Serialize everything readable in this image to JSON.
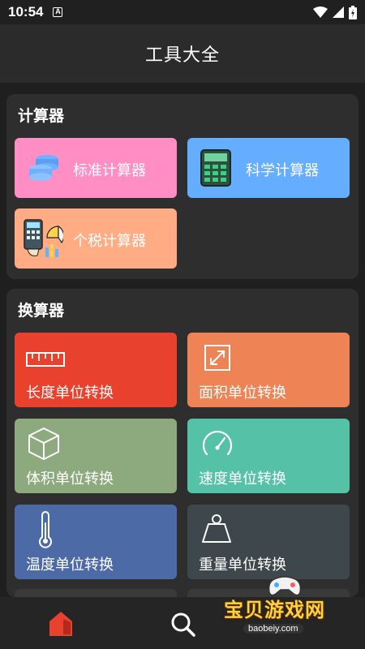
{
  "status_bar": {
    "time": "10:54",
    "notification_icon": "a-box-icon"
  },
  "header": {
    "title": "工具大全"
  },
  "sections": {
    "calculators": {
      "title": "计算器",
      "cards": [
        {
          "label": "标准计算器",
          "color": "#ff8ec5",
          "icon": "coins-icon"
        },
        {
          "label": "科学计算器",
          "color": "#64adff",
          "icon": "calculator-icon"
        },
        {
          "label": "个税计算器",
          "color": "#ffab84",
          "icon": "tax-chart-icon"
        }
      ]
    },
    "converters": {
      "title": "换算器",
      "cards": [
        {
          "label": "长度单位转换",
          "color": "#e8412e",
          "icon": "ruler-icon"
        },
        {
          "label": "面积单位转换",
          "color": "#ee8355",
          "icon": "area-icon"
        },
        {
          "label": "体积单位转换",
          "color": "#8caa7d",
          "icon": "cube-icon"
        },
        {
          "label": "速度单位转换",
          "color": "#55c2a8",
          "icon": "speedometer-icon"
        },
        {
          "label": "温度单位转换",
          "color": "#4c6aa6",
          "icon": "thermometer-icon"
        },
        {
          "label": "重量单位转换",
          "color": "#3e474b",
          "icon": "weight-icon"
        }
      ]
    }
  },
  "bottom_nav": {
    "items": [
      "home-icon",
      "search-icon"
    ]
  },
  "watermark": {
    "title": "宝贝游戏网",
    "url": "baobeiy.com"
  }
}
